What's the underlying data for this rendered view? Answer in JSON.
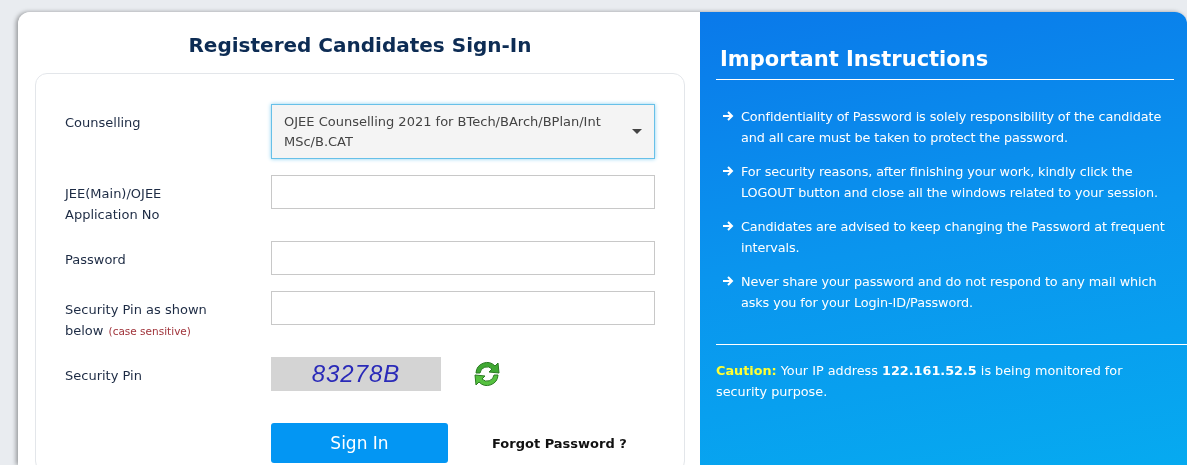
{
  "sign_in": {
    "title": "Registered Candidates Sign-In",
    "fields": [
      {
        "kind": "select",
        "label": "Counselling",
        "value": "OJEE Counselling 2021 for BTech/BArch/BPlan/Int MSc/B.CAT",
        "focused": true
      },
      {
        "kind": "text",
        "label": "JEE(Main)/OJEE Application No",
        "focused": false
      },
      {
        "kind": "password",
        "label": "Password",
        "focused": false
      },
      {
        "kind": "text",
        "label": "Security Pin as shown below",
        "hint": "(case sensitive)",
        "focused": false
      },
      {
        "kind": "captcha",
        "label": "Security Pin",
        "code": "83278B"
      }
    ],
    "submit": "Sign In",
    "forgot": "Forgot Password ?"
  },
  "instructions": {
    "title": "Important Instructions",
    "items": [
      "Confidentiality of Password is solely responsibility of the candidate and all care must be taken to protect the password.",
      "For security reasons, after finishing your work, kindly click the LOGOUT button and close all the windows related to your session.",
      "Candidates are advised to keep changing the Password at frequent intervals.",
      "Never share your password and do not respond to any mail which asks you for your Login-ID/Password."
    ],
    "caution": "**Caution:** Your IP address **122.161.52.5** is being monitored for security purpose."
  }
}
